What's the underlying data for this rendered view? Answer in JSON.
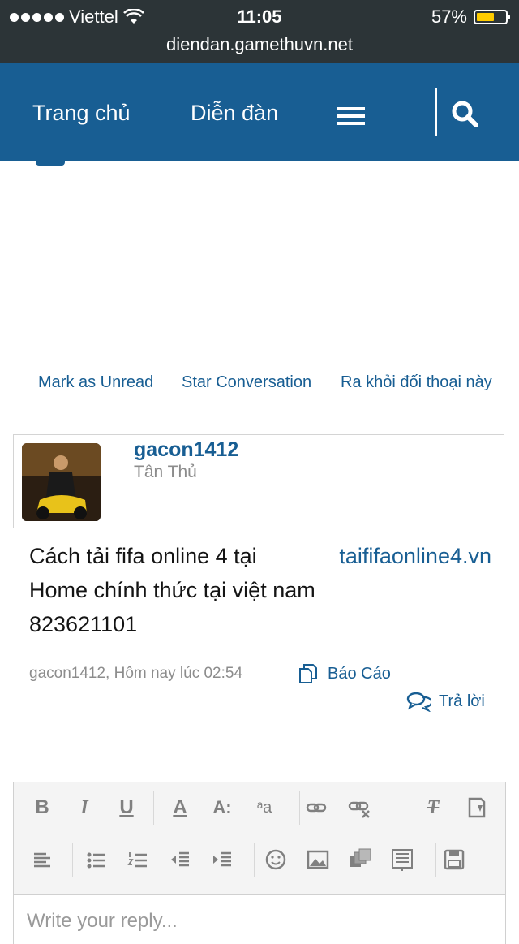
{
  "status_bar": {
    "carrier": "Viettel",
    "time": "11:05",
    "battery": "57%",
    "battery_level": 0.57,
    "url": "diendan.gamethuvn.net"
  },
  "nav": {
    "home": "Trang chủ",
    "forums": "Diễn đàn",
    "menu_icon": "hamburger-icon",
    "search_icon": "search-icon"
  },
  "conversation_actions": {
    "mark_unread": "Mark as Unread",
    "star": "Star Conversation",
    "leave": "Ra khỏi đối thoại này"
  },
  "post": {
    "username": "gacon1412",
    "user_title": "Tân Thủ",
    "message_before_link": "Cách tải fifa online 4 tại",
    "link_text": "taififaonline4.vn",
    "message_line2": "Home chính thức tại việt nam",
    "message_line3": "823621101",
    "meta": "gacon1412, Hôm nay lúc 02:54",
    "report_label": "Báo Cáo",
    "reply_label": "Trả lời"
  },
  "editor": {
    "placeholder": "Write your reply..."
  },
  "colors": {
    "brand": "#185e93",
    "status_bar": "#2c3437",
    "battery": "#ffcc00"
  }
}
